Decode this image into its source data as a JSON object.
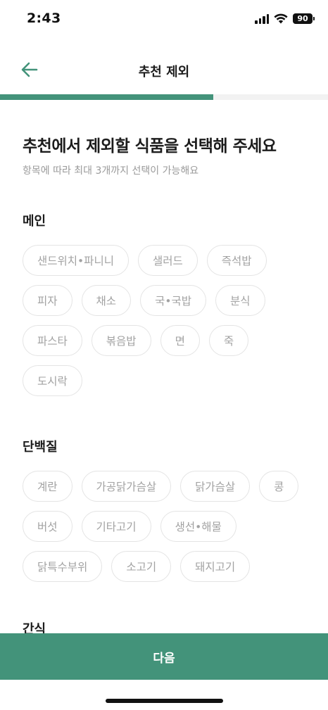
{
  "status_bar": {
    "time": "2:43",
    "battery": "90"
  },
  "header": {
    "title": "추천 제외",
    "back_icon": "arrow-left-icon"
  },
  "progress": {
    "value": 0.65
  },
  "intro": {
    "title": "추천에서 제외할 식품을 선택해 주세요",
    "subtitle": "항목에 따라 최대 3개까지 선택이 가능해요"
  },
  "sections": [
    {
      "title": "메인",
      "items": [
        "샌드위치•파니니",
        "샐러드",
        "즉석밥",
        "피자",
        "채소",
        "국•국밥",
        "분식",
        "파스타",
        "볶음밥",
        "면",
        "죽",
        "도시락"
      ]
    },
    {
      "title": "단백질",
      "items": [
        "계란",
        "가공닭가슴살",
        "닭가슴살",
        "콩",
        "버섯",
        "기타고기",
        "생선•해물",
        "닭특수부위",
        "소고기",
        "돼지고기"
      ]
    },
    {
      "title": "간식",
      "items": []
    }
  ],
  "footer": {
    "next_label": "다음"
  },
  "colors": {
    "accent": "#43937a",
    "chip_border": "#e4e4e4",
    "chip_text": "#a2a2a2"
  }
}
